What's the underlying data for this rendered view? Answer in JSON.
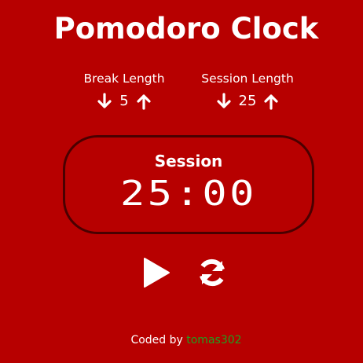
{
  "app": {
    "title": "Pomodoro Clock",
    "background_color": "#b70000"
  },
  "break_control": {
    "label": "Break Length",
    "value": "5",
    "decrement_icon": "arrow-down-icon",
    "increment_icon": "arrow-up-icon"
  },
  "session_control": {
    "label": "Session Length",
    "value": "25",
    "decrement_icon": "arrow-down-icon",
    "increment_icon": "arrow-up-icon"
  },
  "timer": {
    "label": "Session",
    "time": "25:00",
    "border_color": "#4a0000"
  },
  "controls": {
    "play_icon": "play-icon",
    "reset_icon": "refresh-icon"
  },
  "footer": {
    "prefix": "Coded by",
    "author": "tomas302",
    "author_color": "#1fa01f"
  }
}
